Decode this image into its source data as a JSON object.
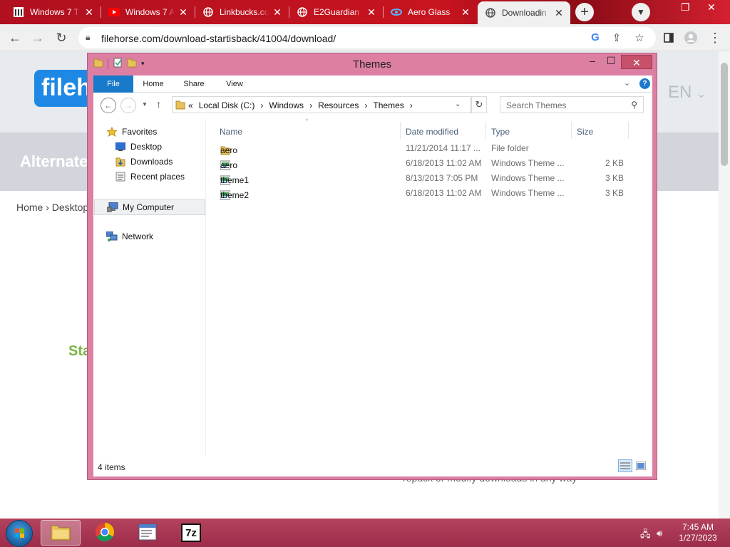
{
  "browser": {
    "tabs": [
      {
        "label": "Windows 7 T",
        "icon": "site-icon"
      },
      {
        "label": "Windows 7 A",
        "icon": "youtube-icon"
      },
      {
        "label": "Linkbucks.co",
        "icon": "globe-icon"
      },
      {
        "label": "E2Guardian -",
        "icon": "globe-icon"
      },
      {
        "label": "Aero Glass",
        "icon": "aero-glass-icon"
      },
      {
        "label": "Downloadin",
        "icon": "globe-icon",
        "active": true
      }
    ],
    "url": "filehorse.com/download-startisback/41004/download/",
    "accent": "#c8141f"
  },
  "website": {
    "logo_text": "fileh",
    "language": "EN",
    "banner_title": "Alternate",
    "breadcrumb": "Home  ›  Desktop",
    "start_text": "Sta",
    "footer_text": "repack or modify downloads in any way"
  },
  "explorer": {
    "title": "Themes",
    "ribbon_tabs": [
      "File",
      "Home",
      "Share",
      "View"
    ],
    "path": [
      "Local Disk (C:)",
      "Windows",
      "Resources",
      "Themes"
    ],
    "path_prefix": "«",
    "search_placeholder": "Search Themes",
    "nav": {
      "favorites": "Favorites",
      "desktop": "Desktop",
      "downloads": "Downloads",
      "recent": "Recent places",
      "computer": "My Computer",
      "network": "Network"
    },
    "columns": [
      "Name",
      "Date modified",
      "Type",
      "Size"
    ],
    "files": [
      {
        "name": "aero",
        "date": "11/21/2014 11:17 ...",
        "type": "File folder",
        "size": "",
        "icon": "folder-icon"
      },
      {
        "name": "aero",
        "date": "6/18/2013 11:02 AM",
        "type": "Windows Theme ...",
        "size": "2 KB",
        "icon": "theme-file-icon"
      },
      {
        "name": "theme1",
        "date": "8/13/2013 7:05 PM",
        "type": "Windows Theme ...",
        "size": "3 KB",
        "icon": "theme-file-icon"
      },
      {
        "name": "theme2",
        "date": "6/18/2013 11:02 AM",
        "type": "Windows Theme ...",
        "size": "3 KB",
        "icon": "theme-file-icon"
      }
    ],
    "status": "4 items",
    "frame_color": "#dc7fa2"
  },
  "taskbar": {
    "apps": [
      "explorer-icon",
      "chrome-icon",
      "notepad-icon",
      "7zip-icon"
    ],
    "sevenzip_label": "7z",
    "time": "7:45 AM",
    "date": "1/27/2023"
  }
}
